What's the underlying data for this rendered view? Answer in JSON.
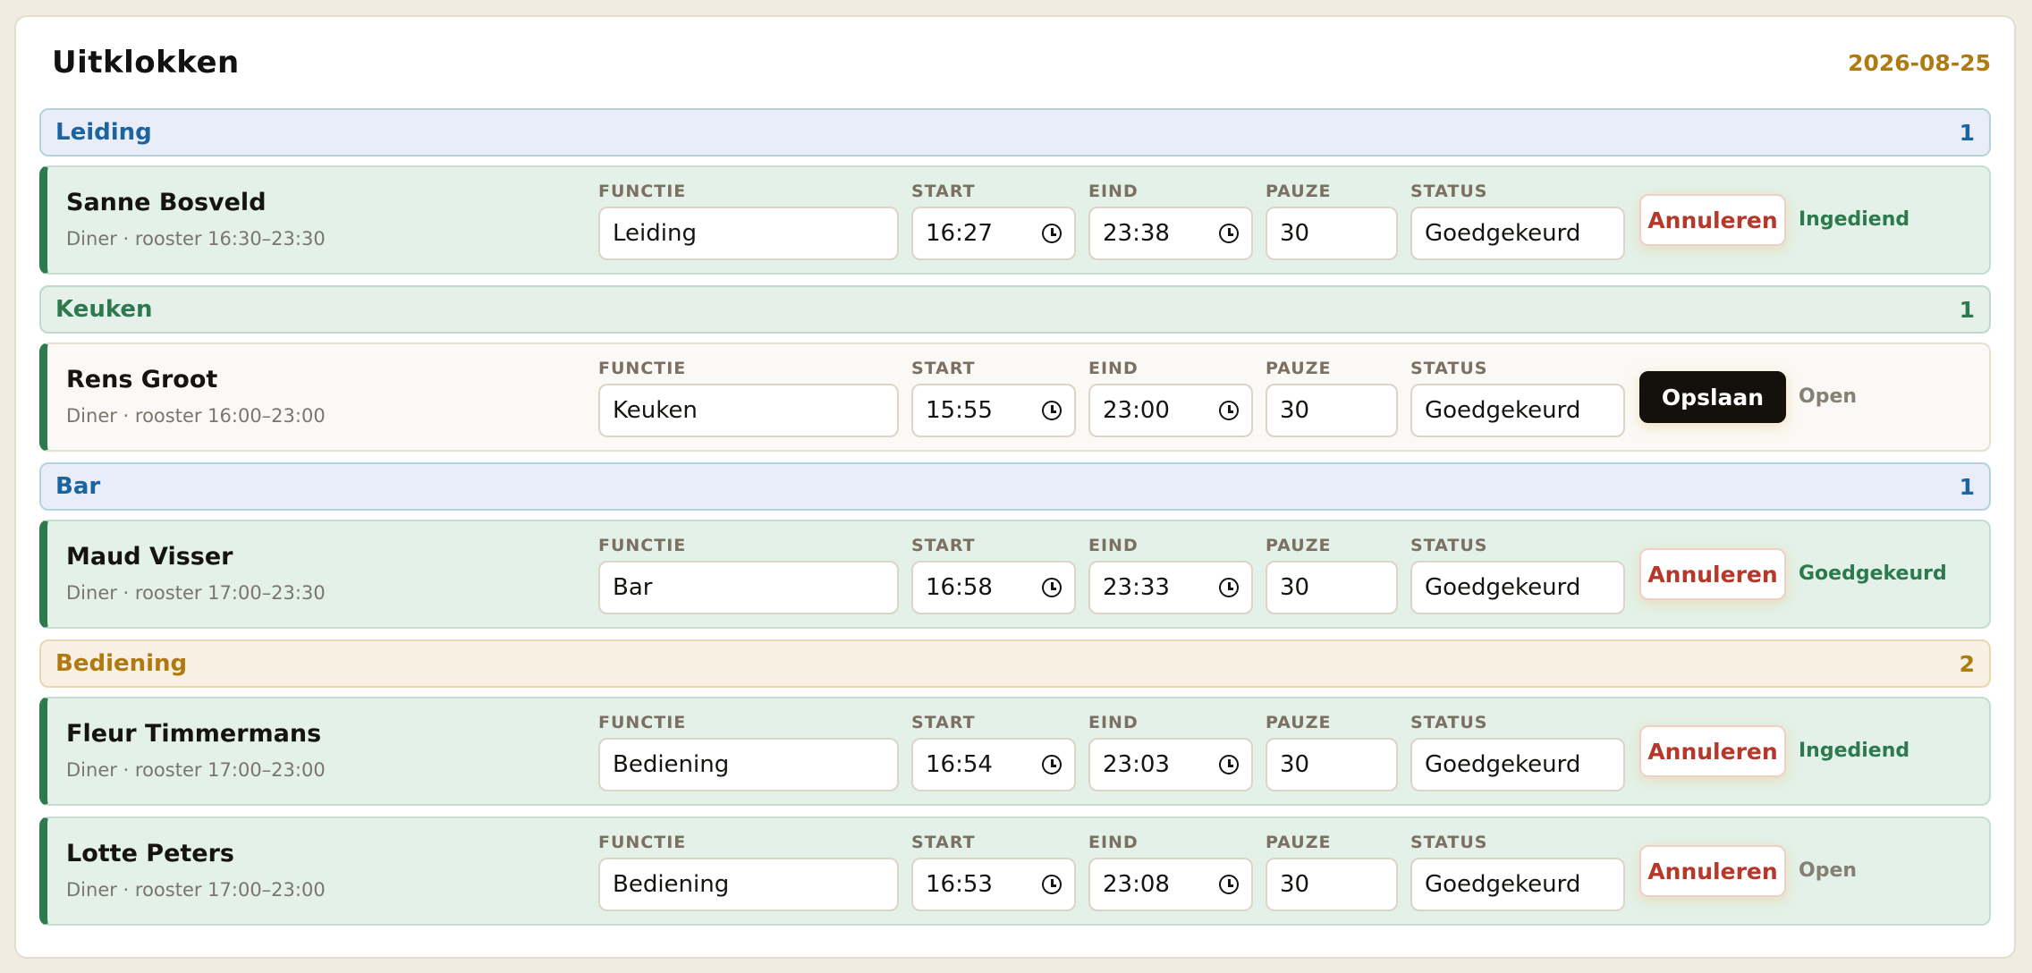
{
  "header": {
    "title": "Uitklokken",
    "date": "2026-08-25"
  },
  "labels": {
    "functie": "FUNCTIE",
    "start": "START",
    "eind": "EIND",
    "pauze": "PAUZE",
    "status": "STATUS"
  },
  "groups": [
    {
      "name": "Leiding",
      "count": "1",
      "color": "#1b64a0",
      "rows": [
        {
          "name": "Sanne Bosveld",
          "sub": "Diner · rooster 16:30–23:30",
          "functie": "Leiding",
          "start": "16:27",
          "eind": "23:38",
          "pauze": "30",
          "status": "Goedgekeurd",
          "action": "Annuleren",
          "state": "Ingediend"
        }
      ]
    },
    {
      "name": "Keuken",
      "count": "1",
      "color": "#2e7a4f",
      "rows": [
        {
          "name": "Rens Groot",
          "sub": "Diner · rooster 16:00–23:00",
          "functie": "Keuken",
          "start": "15:55",
          "eind": "23:00",
          "pauze": "30",
          "status": "Goedgekeurd",
          "action": "Opslaan",
          "state": "Open"
        }
      ]
    },
    {
      "name": "Bar",
      "count": "1",
      "color": "#1b64a0",
      "rows": [
        {
          "name": "Maud Visser",
          "sub": "Diner · rooster 17:00–23:30",
          "functie": "Bar",
          "start": "16:58",
          "eind": "23:33",
          "pauze": "30",
          "status": "Goedgekeurd",
          "action": "Annuleren",
          "state": "Goedgekeurd"
        }
      ]
    },
    {
      "name": "Bediening",
      "count": "2",
      "color": "#b07a12",
      "rows": [
        {
          "name": "Fleur Timmermans",
          "sub": "Diner · rooster 17:00–23:00",
          "functie": "Bediening",
          "start": "16:54",
          "eind": "23:03",
          "pauze": "30",
          "status": "Goedgekeurd",
          "action": "Annuleren",
          "state": "Ingediend"
        },
        {
          "name": "Lotte Peters",
          "sub": "Diner · rooster 17:00–23:00",
          "functie": "Bediening",
          "start": "16:53",
          "eind": "23:08",
          "pauze": "30",
          "status": "Goedgekeurd",
          "action": "Annuleren",
          "state": "Open"
        }
      ]
    }
  ]
}
